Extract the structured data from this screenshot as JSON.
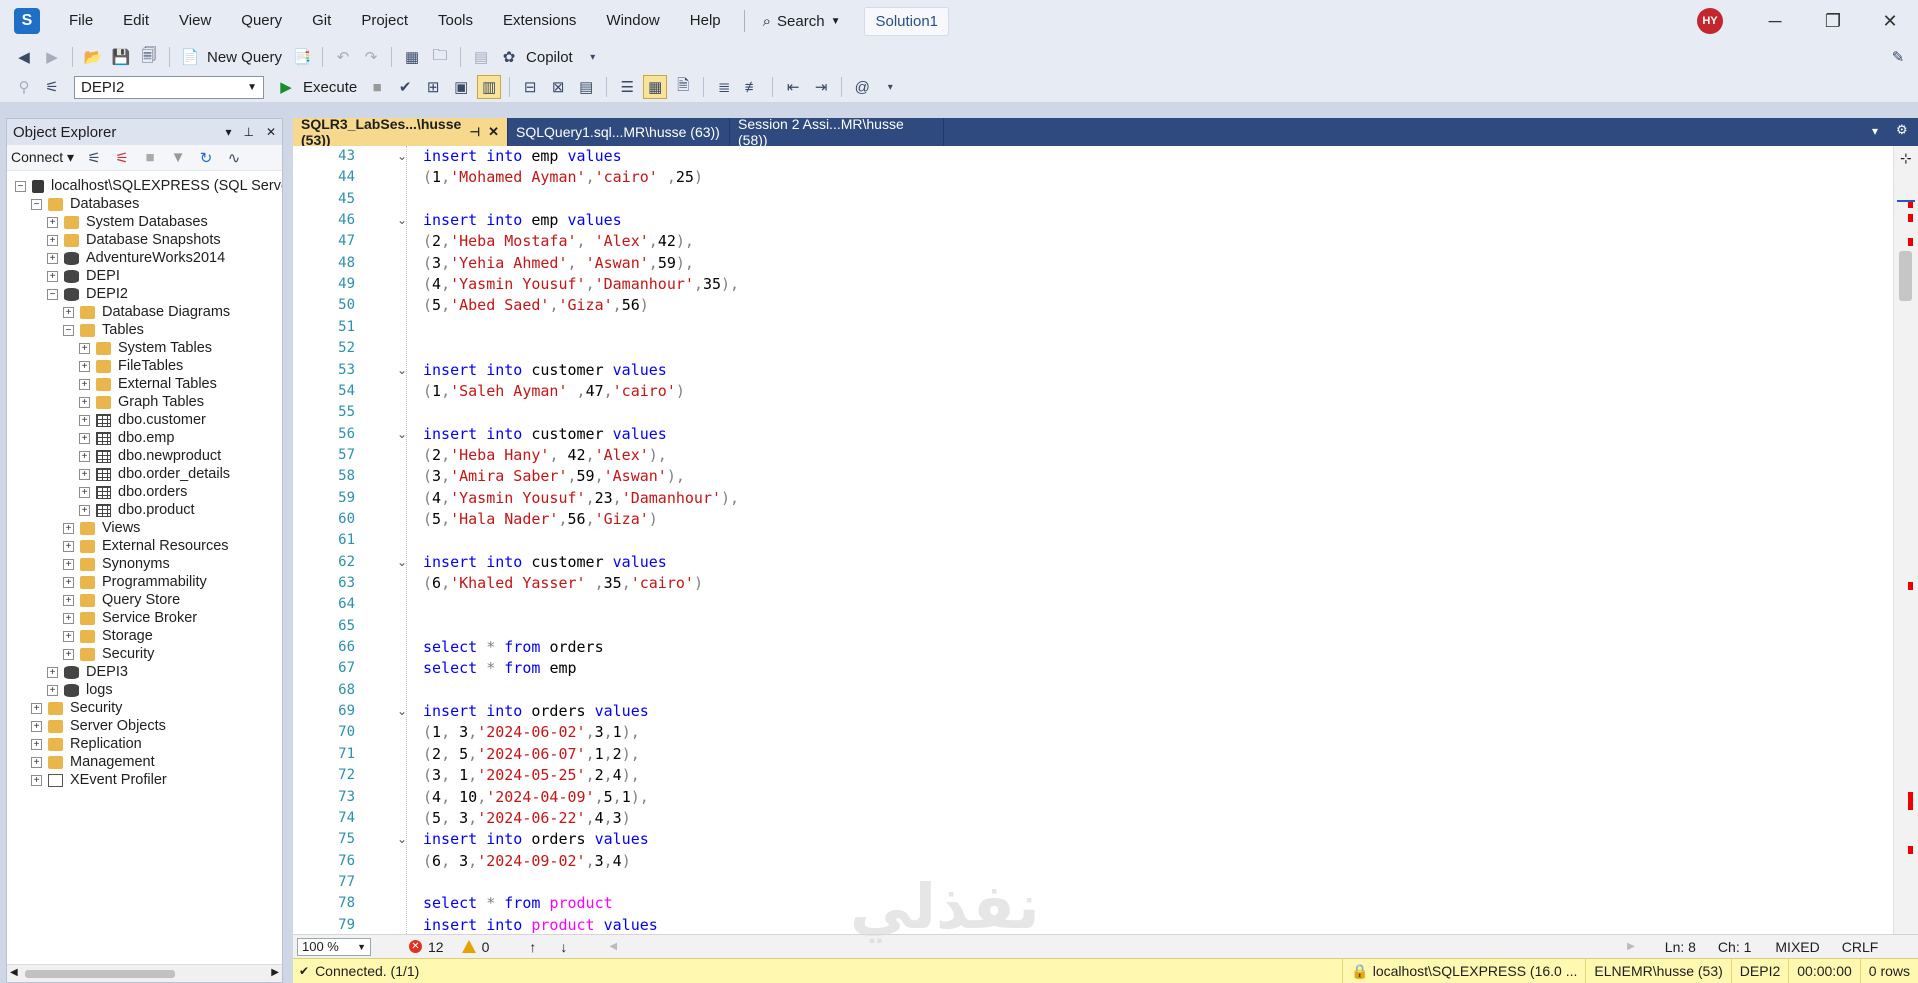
{
  "menu": {
    "items": [
      "File",
      "Edit",
      "View",
      "Query",
      "Git",
      "Project",
      "Tools",
      "Extensions",
      "Window",
      "Help"
    ],
    "search_label": "Search",
    "solution": "Solution1",
    "avatar_initials": "HY"
  },
  "toolbar1": {
    "new_query": "New Query",
    "copilot": "Copilot"
  },
  "toolbar2": {
    "database": "DEPI2",
    "execute": "Execute"
  },
  "object_explorer": {
    "title": "Object Explorer",
    "connect": "Connect",
    "nodes": [
      {
        "label": "localhost\\SQLEXPRESS (SQL Server",
        "level": 0,
        "exp": "-",
        "icon": "server"
      },
      {
        "label": "Databases",
        "level": 1,
        "exp": "-",
        "icon": "folder"
      },
      {
        "label": "System Databases",
        "level": 2,
        "exp": "+",
        "icon": "folder"
      },
      {
        "label": "Database Snapshots",
        "level": 2,
        "exp": "+",
        "icon": "folder"
      },
      {
        "label": "AdventureWorks2014",
        "level": 2,
        "exp": "+",
        "icon": "db"
      },
      {
        "label": "DEPI",
        "level": 2,
        "exp": "+",
        "icon": "db"
      },
      {
        "label": "DEPI2",
        "level": 2,
        "exp": "-",
        "icon": "db"
      },
      {
        "label": "Database Diagrams",
        "level": 3,
        "exp": "+",
        "icon": "folder"
      },
      {
        "label": "Tables",
        "level": 3,
        "exp": "-",
        "icon": "folder"
      },
      {
        "label": "System Tables",
        "level": 4,
        "exp": "+",
        "icon": "folder"
      },
      {
        "label": "FileTables",
        "level": 4,
        "exp": "+",
        "icon": "folder"
      },
      {
        "label": "External Tables",
        "level": 4,
        "exp": "+",
        "icon": "folder"
      },
      {
        "label": "Graph Tables",
        "level": 4,
        "exp": "+",
        "icon": "folder"
      },
      {
        "label": "dbo.customer",
        "level": 4,
        "exp": "+",
        "icon": "table"
      },
      {
        "label": "dbo.emp",
        "level": 4,
        "exp": "+",
        "icon": "table"
      },
      {
        "label": "dbo.newproduct",
        "level": 4,
        "exp": "+",
        "icon": "table"
      },
      {
        "label": "dbo.order_details",
        "level": 4,
        "exp": "+",
        "icon": "table"
      },
      {
        "label": "dbo.orders",
        "level": 4,
        "exp": "+",
        "icon": "table"
      },
      {
        "label": "dbo.product",
        "level": 4,
        "exp": "+",
        "icon": "table"
      },
      {
        "label": "Views",
        "level": 3,
        "exp": "+",
        "icon": "folder"
      },
      {
        "label": "External Resources",
        "level": 3,
        "exp": "+",
        "icon": "folder"
      },
      {
        "label": "Synonyms",
        "level": 3,
        "exp": "+",
        "icon": "folder"
      },
      {
        "label": "Programmability",
        "level": 3,
        "exp": "+",
        "icon": "folder"
      },
      {
        "label": "Query Store",
        "level": 3,
        "exp": "+",
        "icon": "folder"
      },
      {
        "label": "Service Broker",
        "level": 3,
        "exp": "+",
        "icon": "folder"
      },
      {
        "label": "Storage",
        "level": 3,
        "exp": "+",
        "icon": "folder"
      },
      {
        "label": "Security",
        "level": 3,
        "exp": "+",
        "icon": "folder"
      },
      {
        "label": "DEPI3",
        "level": 2,
        "exp": "+",
        "icon": "db"
      },
      {
        "label": "logs",
        "level": 2,
        "exp": "+",
        "icon": "db"
      },
      {
        "label": "Security",
        "level": 1,
        "exp": "+",
        "icon": "folder"
      },
      {
        "label": "Server Objects",
        "level": 1,
        "exp": "+",
        "icon": "folder"
      },
      {
        "label": "Replication",
        "level": 1,
        "exp": "+",
        "icon": "folder"
      },
      {
        "label": "Management",
        "level": 1,
        "exp": "+",
        "icon": "folder"
      },
      {
        "label": "XEvent Profiler",
        "level": 1,
        "exp": "+",
        "icon": "xevent"
      }
    ]
  },
  "tabs": [
    {
      "label": "SQLR3_LabSes...\\husse (53))",
      "active": true
    },
    {
      "label": "SQLQuery1.sql...MR\\husse (63))",
      "active": false
    },
    {
      "label": "Session 2 Assi...MR\\husse (58))",
      "active": false
    }
  ],
  "code_lines": [
    {
      "n": "43",
      "fold": true,
      "code": [
        [
          "kw",
          "insert into "
        ],
        [
          "",
          "emp "
        ],
        [
          "kw",
          "values"
        ]
      ]
    },
    {
      "n": "44",
      "code": [
        [
          "op",
          "("
        ],
        [
          "",
          "1"
        ],
        [
          "op",
          ","
        ],
        [
          "str",
          "'Mohamed Ayman'"
        ],
        [
          "op",
          ","
        ],
        [
          "str",
          "'cairo'"
        ],
        [
          "op",
          " ,"
        ],
        [
          "",
          "25"
        ],
        [
          "op",
          ")"
        ]
      ]
    },
    {
      "n": "45",
      "code": []
    },
    {
      "n": "46",
      "fold": true,
      "code": [
        [
          "kw",
          "insert into "
        ],
        [
          "",
          "emp "
        ],
        [
          "kw",
          "values"
        ]
      ]
    },
    {
      "n": "47",
      "code": [
        [
          "op",
          "("
        ],
        [
          "",
          "2"
        ],
        [
          "op",
          ","
        ],
        [
          "str",
          "'Heba Mostafa'"
        ],
        [
          "op",
          ", "
        ],
        [
          "str",
          "'Alex'"
        ],
        [
          "op",
          ","
        ],
        [
          "",
          "42"
        ],
        [
          "op",
          "),"
        ]
      ]
    },
    {
      "n": "48",
      "code": [
        [
          "op",
          "("
        ],
        [
          "",
          "3"
        ],
        [
          "op",
          ","
        ],
        [
          "str",
          "'Yehia Ahmed'"
        ],
        [
          "op",
          ", "
        ],
        [
          "str",
          "'Aswan'"
        ],
        [
          "op",
          ","
        ],
        [
          "",
          "59"
        ],
        [
          "op",
          "),"
        ]
      ]
    },
    {
      "n": "49",
      "code": [
        [
          "op",
          "("
        ],
        [
          "",
          "4"
        ],
        [
          "op",
          ","
        ],
        [
          "str",
          "'Yasmin Yousuf'"
        ],
        [
          "op",
          ","
        ],
        [
          "str",
          "'Damanhour'"
        ],
        [
          "op",
          ","
        ],
        [
          "",
          "35"
        ],
        [
          "op",
          "),"
        ]
      ]
    },
    {
      "n": "50",
      "code": [
        [
          "op",
          "("
        ],
        [
          "",
          "5"
        ],
        [
          "op",
          ","
        ],
        [
          "str",
          "'Abed Saed'"
        ],
        [
          "op",
          ","
        ],
        [
          "str",
          "'Giza'"
        ],
        [
          "op",
          ","
        ],
        [
          "",
          "56"
        ],
        [
          "op",
          ")"
        ]
      ]
    },
    {
      "n": "51",
      "code": []
    },
    {
      "n": "52",
      "code": []
    },
    {
      "n": "53",
      "fold": true,
      "code": [
        [
          "kw",
          "insert into "
        ],
        [
          "",
          "customer "
        ],
        [
          "kw",
          "values"
        ]
      ]
    },
    {
      "n": "54",
      "code": [
        [
          "op",
          "("
        ],
        [
          "",
          "1"
        ],
        [
          "op",
          ","
        ],
        [
          "str",
          "'Saleh Ayman'"
        ],
        [
          "op",
          " ,"
        ],
        [
          "",
          "47"
        ],
        [
          "op",
          ","
        ],
        [
          "str",
          "'cairo'"
        ],
        [
          "op",
          ")"
        ]
      ]
    },
    {
      "n": "55",
      "code": []
    },
    {
      "n": "56",
      "fold": true,
      "code": [
        [
          "kw",
          "insert into "
        ],
        [
          "",
          "customer "
        ],
        [
          "kw",
          "values"
        ]
      ]
    },
    {
      "n": "57",
      "code": [
        [
          "op",
          "("
        ],
        [
          "",
          "2"
        ],
        [
          "op",
          ","
        ],
        [
          "str",
          "'Heba Hany'"
        ],
        [
          "op",
          ", "
        ],
        [
          "",
          "42"
        ],
        [
          "op",
          ","
        ],
        [
          "str",
          "'Alex'"
        ],
        [
          "op",
          "),"
        ]
      ]
    },
    {
      "n": "58",
      "code": [
        [
          "op",
          "("
        ],
        [
          "",
          "3"
        ],
        [
          "op",
          ","
        ],
        [
          "str",
          "'Amira Saber'"
        ],
        [
          "op",
          ","
        ],
        [
          "",
          "59"
        ],
        [
          "op",
          ","
        ],
        [
          "str",
          "'Aswan'"
        ],
        [
          "op",
          "),"
        ]
      ]
    },
    {
      "n": "59",
      "code": [
        [
          "op",
          "("
        ],
        [
          "",
          "4"
        ],
        [
          "op",
          ","
        ],
        [
          "str",
          "'Yasmin Yousuf'"
        ],
        [
          "op",
          ","
        ],
        [
          "",
          "23"
        ],
        [
          "op",
          ","
        ],
        [
          "str",
          "'Damanhour'"
        ],
        [
          "op",
          "),"
        ]
      ]
    },
    {
      "n": "60",
      "code": [
        [
          "op",
          "("
        ],
        [
          "",
          "5"
        ],
        [
          "op",
          ","
        ],
        [
          "str",
          "'Hala Nader'"
        ],
        [
          "op",
          ","
        ],
        [
          "",
          "56"
        ],
        [
          "op",
          ","
        ],
        [
          "str",
          "'Giza'"
        ],
        [
          "op",
          ")"
        ]
      ]
    },
    {
      "n": "61",
      "code": []
    },
    {
      "n": "62",
      "fold": true,
      "code": [
        [
          "kw",
          "insert into "
        ],
        [
          "",
          "customer "
        ],
        [
          "kw",
          "values"
        ]
      ]
    },
    {
      "n": "63",
      "code": [
        [
          "op",
          "("
        ],
        [
          "",
          "6"
        ],
        [
          "op",
          ","
        ],
        [
          "str",
          "'Khaled Yasser'"
        ],
        [
          "op",
          " ,"
        ],
        [
          "",
          "35"
        ],
        [
          "op",
          ","
        ],
        [
          "str",
          "'cairo'"
        ],
        [
          "op",
          ")"
        ]
      ]
    },
    {
      "n": "64",
      "code": []
    },
    {
      "n": "65",
      "code": []
    },
    {
      "n": "66",
      "code": [
        [
          "kw",
          "select "
        ],
        [
          "op",
          "* "
        ],
        [
          "kw",
          "from "
        ],
        [
          "",
          "orders"
        ]
      ]
    },
    {
      "n": "67",
      "code": [
        [
          "kw",
          "select "
        ],
        [
          "op",
          "* "
        ],
        [
          "kw",
          "from "
        ],
        [
          "",
          "emp"
        ]
      ]
    },
    {
      "n": "68",
      "code": []
    },
    {
      "n": "69",
      "fold": true,
      "code": [
        [
          "kw",
          "insert into "
        ],
        [
          "",
          "orders "
        ],
        [
          "kw",
          "values"
        ]
      ]
    },
    {
      "n": "70",
      "code": [
        [
          "op",
          "("
        ],
        [
          "",
          "1"
        ],
        [
          "op",
          ", "
        ],
        [
          "",
          "3"
        ],
        [
          "op",
          ","
        ],
        [
          "str",
          "'2024-06-02'"
        ],
        [
          "op",
          ","
        ],
        [
          "",
          "3"
        ],
        [
          "op",
          ","
        ],
        [
          "",
          "1"
        ],
        [
          "op",
          "),"
        ]
      ]
    },
    {
      "n": "71",
      "code": [
        [
          "op",
          "("
        ],
        [
          "",
          "2"
        ],
        [
          "op",
          ", "
        ],
        [
          "",
          "5"
        ],
        [
          "op",
          ","
        ],
        [
          "str",
          "'2024-06-07'"
        ],
        [
          "op",
          ","
        ],
        [
          "",
          "1"
        ],
        [
          "op",
          ","
        ],
        [
          "",
          "2"
        ],
        [
          "op",
          "),"
        ]
      ]
    },
    {
      "n": "72",
      "code": [
        [
          "op",
          "("
        ],
        [
          "",
          "3"
        ],
        [
          "op",
          ", "
        ],
        [
          "",
          "1"
        ],
        [
          "op",
          ","
        ],
        [
          "str",
          "'2024-05-25'"
        ],
        [
          "op",
          ","
        ],
        [
          "",
          "2"
        ],
        [
          "op",
          ","
        ],
        [
          "",
          "4"
        ],
        [
          "op",
          "),"
        ]
      ]
    },
    {
      "n": "73",
      "code": [
        [
          "op",
          "("
        ],
        [
          "",
          "4"
        ],
        [
          "op",
          ", "
        ],
        [
          "",
          "10"
        ],
        [
          "op",
          ","
        ],
        [
          "str",
          "'2024-04-09'"
        ],
        [
          "op",
          ","
        ],
        [
          "",
          "5"
        ],
        [
          "op",
          ","
        ],
        [
          "",
          "1"
        ],
        [
          "op",
          "),"
        ]
      ]
    },
    {
      "n": "74",
      "code": [
        [
          "op",
          "("
        ],
        [
          "",
          "5"
        ],
        [
          "op",
          ", "
        ],
        [
          "",
          "3"
        ],
        [
          "op",
          ","
        ],
        [
          "str",
          "'2024-06-22'"
        ],
        [
          "op",
          ","
        ],
        [
          "",
          "4"
        ],
        [
          "op",
          ","
        ],
        [
          "",
          "3"
        ],
        [
          "op",
          ")"
        ]
      ]
    },
    {
      "n": "75",
      "fold": true,
      "code": [
        [
          "kw",
          "insert into "
        ],
        [
          "",
          "orders "
        ],
        [
          "kw",
          "values"
        ]
      ]
    },
    {
      "n": "76",
      "code": [
        [
          "op",
          "("
        ],
        [
          "",
          "6"
        ],
        [
          "op",
          ", "
        ],
        [
          "",
          "3"
        ],
        [
          "op",
          ","
        ],
        [
          "str",
          "'2024-09-02'"
        ],
        [
          "op",
          ","
        ],
        [
          "",
          "3"
        ],
        [
          "op",
          ","
        ],
        [
          "",
          "4"
        ],
        [
          "op",
          ")"
        ]
      ]
    },
    {
      "n": "77",
      "code": []
    },
    {
      "n": "78",
      "code": [
        [
          "kw",
          "select "
        ],
        [
          "op",
          "* "
        ],
        [
          "kw",
          "from "
        ],
        [
          "fn",
          "product"
        ]
      ]
    },
    {
      "n": "79",
      "code": [
        [
          "kw",
          "insert into "
        ],
        [
          "fn",
          "product "
        ],
        [
          "kw",
          "values"
        ]
      ]
    }
  ],
  "editor_status": {
    "zoom": "100 %",
    "errors": "12",
    "warnings": "0",
    "ln": "Ln: 8",
    "ch": "Ch: 1",
    "mixed": "MIXED",
    "crlf": "CRLF"
  },
  "status_bar": {
    "connected": "Connected. (1/1)",
    "server": "localhost\\SQLEXPRESS (16.0 ...",
    "user": "ELNEMR\\husse (53)",
    "db": "DEPI2",
    "time": "00:00:00",
    "rows": "0 rows"
  },
  "watermark": "نفذلي"
}
